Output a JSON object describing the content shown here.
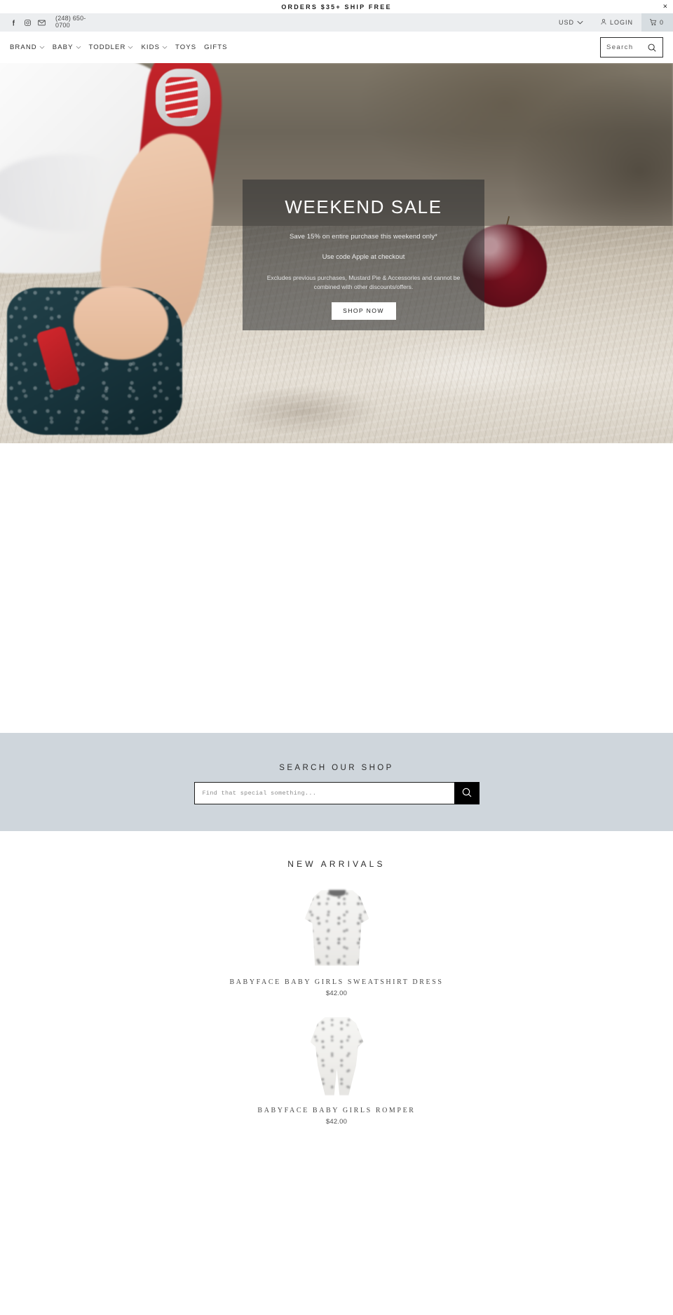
{
  "announcement": {
    "text": "ORDERS $35+ SHIP FREE",
    "close_label": "×"
  },
  "utility": {
    "icons": [
      {
        "name": "facebook-icon",
        "label": "Facebook"
      },
      {
        "name": "instagram-icon",
        "label": "Instagram"
      },
      {
        "name": "email-icon",
        "label": "Email"
      }
    ],
    "phone": "(248) 650-0700",
    "currency": "USD",
    "currency_caret": "⌄",
    "login_label": "LOGIN",
    "cart_count": "0"
  },
  "nav": {
    "items": [
      {
        "label": "BRAND",
        "has_dropdown": true
      },
      {
        "label": "BABY",
        "has_dropdown": true
      },
      {
        "label": "TODDLER",
        "has_dropdown": true
      },
      {
        "label": "KIDS",
        "has_dropdown": true
      },
      {
        "label": "TOYS",
        "has_dropdown": false
      },
      {
        "label": "GIFTS",
        "has_dropdown": false
      }
    ],
    "caret": "⌄",
    "search_placeholder": "Search",
    "search_value": ""
  },
  "hero": {
    "title": "WEEKEND SALE",
    "subtitle": "Save 15% on entire purchase this weekend only*",
    "subtitle2": "Use code Apple at checkout",
    "fine_print": "Excludes previous purchases, Mustard Pie & Accessories and cannot be combined with other discounts/offers.",
    "button_label": "SHOP NOW"
  },
  "search_section": {
    "title": "SEARCH OUR SHOP",
    "placeholder": "Find that special something...",
    "value": "",
    "button_name": "search-submit-button"
  },
  "arrivals": {
    "title": "NEW ARRIVALS",
    "products": [
      {
        "name": "BABYFACE BABY GIRLS SWEATSHIRT DRESS",
        "price": "$42.00",
        "image": "sweatshirt-dress-photo"
      },
      {
        "name": "BABYFACE BABY GIRLS ROMPER",
        "price": "$42.00",
        "image": "romper-photo"
      }
    ]
  },
  "colors": {
    "announcement_text": "#1b1b1b",
    "utility_bg": "#eceef0",
    "cart_bg": "#d7dde1",
    "search_band_bg": "#cfd6dc",
    "hero_overlay": "rgba(40,42,44,0.55)",
    "button_bg": "#ffffff",
    "submit_bg": "#000000"
  }
}
